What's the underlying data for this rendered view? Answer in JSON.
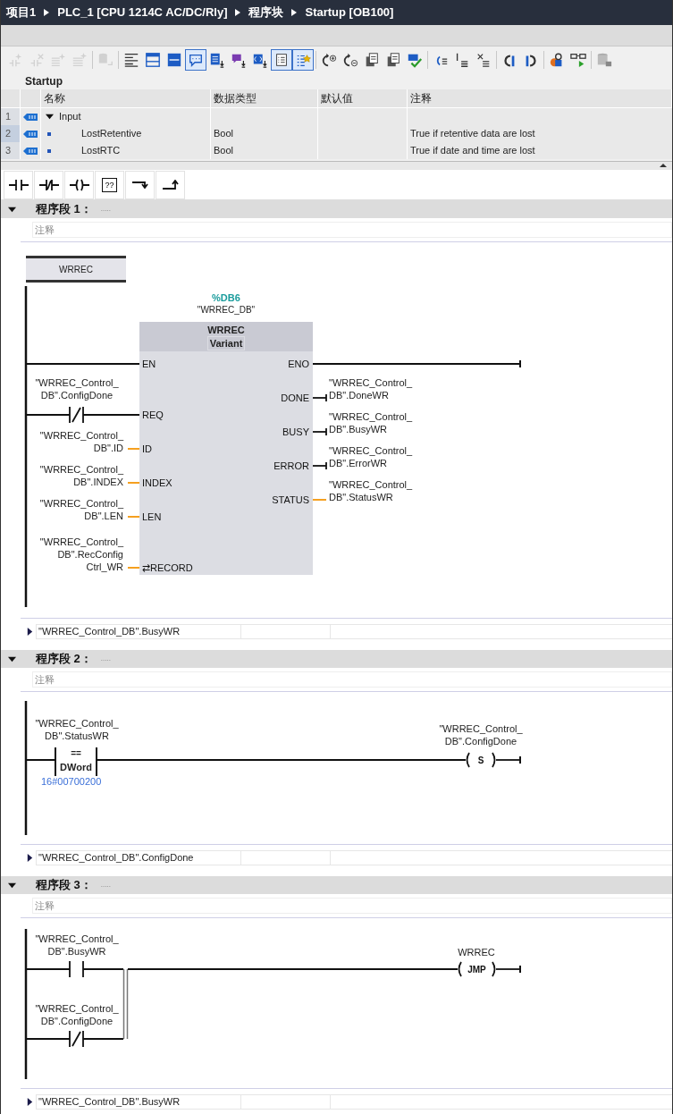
{
  "breadcrumb": [
    "项目1",
    "PLC_1 [CPU 1214C AC/DC/Rly]",
    "程序块",
    "Startup [OB100]"
  ],
  "toolbar": [
    {
      "items": [
        {
          "kind": "network-add",
          "selected": false,
          "disabled": true
        },
        {
          "kind": "network-delete",
          "selected": false,
          "disabled": true
        },
        {
          "kind": "rows-insert",
          "selected": false,
          "disabled": true
        },
        {
          "kind": "rows-append",
          "selected": false,
          "disabled": true
        }
      ]
    },
    {
      "items": [
        {
          "kind": "db-link",
          "selected": false,
          "disabled": true
        }
      ]
    },
    {
      "items": [
        {
          "kind": "lines-left",
          "selected": false,
          "disabled": false
        },
        {
          "kind": "window",
          "selected": false,
          "disabled": false
        },
        {
          "kind": "window-filled",
          "selected": false,
          "disabled": false
        },
        {
          "kind": "comment",
          "selected": true,
          "disabled": false
        },
        {
          "kind": "list-down",
          "selected": false,
          "disabled": false
        },
        {
          "kind": "bubble-down",
          "selected": false,
          "disabled": false
        },
        {
          "kind": "brackets-down",
          "selected": false,
          "disabled": false
        },
        {
          "kind": "list-box",
          "selected": true,
          "disabled": false
        },
        {
          "kind": "star-list",
          "selected": true,
          "disabled": false
        }
      ]
    },
    {
      "items": [
        {
          "kind": "goto-plus",
          "selected": false,
          "disabled": false
        },
        {
          "kind": "goto-minus",
          "selected": false,
          "disabled": false
        },
        {
          "kind": "pages",
          "selected": false,
          "disabled": false
        },
        {
          "kind": "pages",
          "selected": false,
          "disabled": false
        },
        {
          "kind": "check",
          "selected": false,
          "disabled": false
        }
      ]
    },
    {
      "items": [
        {
          "kind": "arrow-list",
          "selected": false,
          "disabled": false
        },
        {
          "kind": "marker-list",
          "selected": false,
          "disabled": false
        },
        {
          "kind": "branch-list",
          "selected": false,
          "disabled": false
        }
      ]
    },
    {
      "items": [
        {
          "kind": "bookmark-prev",
          "selected": false,
          "disabled": false
        },
        {
          "kind": "bookmark-next",
          "selected": false,
          "disabled": false
        }
      ]
    },
    {
      "items": [
        {
          "kind": "shapes-search",
          "selected": false,
          "disabled": false
        },
        {
          "kind": "glasses",
          "selected": false,
          "disabled": false
        }
      ]
    },
    {
      "items": [
        {
          "kind": "db-lock",
          "selected": false,
          "disabled": false
        }
      ]
    }
  ],
  "interface": {
    "title": "Startup",
    "columns": [
      "名称",
      "数据类型",
      "默认值",
      "注释"
    ],
    "rows": [
      {
        "kind": "section",
        "number": "1",
        "name": "Input",
        "expanded": true,
        "selected": false
      },
      {
        "kind": "parameter",
        "number": "2",
        "name": "LostRetentive",
        "data_type": "Bool",
        "comment": "True if retentive data are lost",
        "selected": true
      },
      {
        "kind": "parameter",
        "number": "3",
        "name": "LostRTC",
        "data_type": "Bool",
        "comment": "True if date and time are lost",
        "selected": false
      }
    ]
  },
  "palette": [
    {
      "kind": "no-contact"
    },
    {
      "kind": "nc-contact"
    },
    {
      "kind": "coil"
    },
    {
      "kind": "box",
      "label": "??"
    },
    {
      "kind": "branch-open"
    },
    {
      "kind": "branch-close"
    }
  ],
  "networks": [
    {
      "kind": "fb-call",
      "title": "程序段 1：",
      "dots": ".....",
      "comment": "注释",
      "expanded": true,
      "label": "WRREC",
      "instance": "%DB6",
      "instance_name": "\"WRREC_DB\"",
      "block": "WRREC",
      "block_type": "Variant",
      "inputs": [
        {
          "pin": "EN",
          "kind": "bool"
        },
        {
          "pin": "REQ",
          "kind": "bool",
          "contact": {
            "kind": "nc"
          },
          "operand": [
            "\"WRREC_Control_",
            "DB\".ConfigDone"
          ]
        },
        {
          "pin": "ID",
          "kind": "data",
          "operand": [
            "\"WRREC_Control_",
            "DB\".ID"
          ]
        },
        {
          "pin": "INDEX",
          "kind": "data",
          "operand": [
            "\"WRREC_Control_",
            "DB\".INDEX"
          ]
        },
        {
          "pin": "LEN",
          "kind": "data",
          "operand": [
            "\"WRREC_Control_",
            "DB\".LEN"
          ]
        },
        {
          "pin": "RECORD",
          "symbol": "⇄",
          "kind": "data",
          "operand": [
            "\"WRREC_Control_",
            "DB\".RecConfig",
            "Ctrl_WR"
          ]
        }
      ],
      "outputs": [
        {
          "pin": "ENO",
          "kind": "bool"
        },
        {
          "pin": "DONE",
          "kind": "bool",
          "operand": [
            "\"WRREC_Control_",
            "DB\".DoneWR"
          ]
        },
        {
          "pin": "BUSY",
          "kind": "bool",
          "operand": [
            "\"WRREC_Control_",
            "DB\".BusyWR"
          ]
        },
        {
          "pin": "ERROR",
          "kind": "bool",
          "operand": [
            "\"WRREC_Control_",
            "DB\".ErrorWR"
          ]
        },
        {
          "pin": "STATUS",
          "kind": "data",
          "operand": [
            "\"WRREC_Control_",
            "DB\".StatusWR"
          ]
        }
      ],
      "info": "\"WRREC_Control_DB\".BusyWR"
    },
    {
      "kind": "compare-set",
      "title": "程序段 2：",
      "dots": ".....",
      "comment": "注释",
      "expanded": true,
      "operand": [
        "\"WRREC_Control_",
        "DB\".StatusWR"
      ],
      "operator": "==",
      "data_type": "DWord",
      "value": "16#00700200",
      "coil": {
        "type": "S",
        "operand": [
          "\"WRREC_Control_",
          "DB\".ConfigDone"
        ]
      },
      "info": "\"WRREC_Control_DB\".ConfigDone"
    },
    {
      "kind": "jump",
      "title": "程序段 3：",
      "dots": ".....",
      "comment": "注释",
      "expanded": true,
      "branches": [
        {
          "kind": "no",
          "operand": [
            "\"WRREC_Control_",
            "DB\".BusyWR"
          ]
        },
        {
          "kind": "nc",
          "operand": [
            "\"WRREC_Control_",
            "DB\".ConfigDone"
          ]
        }
      ],
      "coil": {
        "type": "JMP",
        "operand": [
          "WRREC"
        ]
      },
      "info": "\"WRREC_Control_DB\".BusyWR"
    }
  ]
}
